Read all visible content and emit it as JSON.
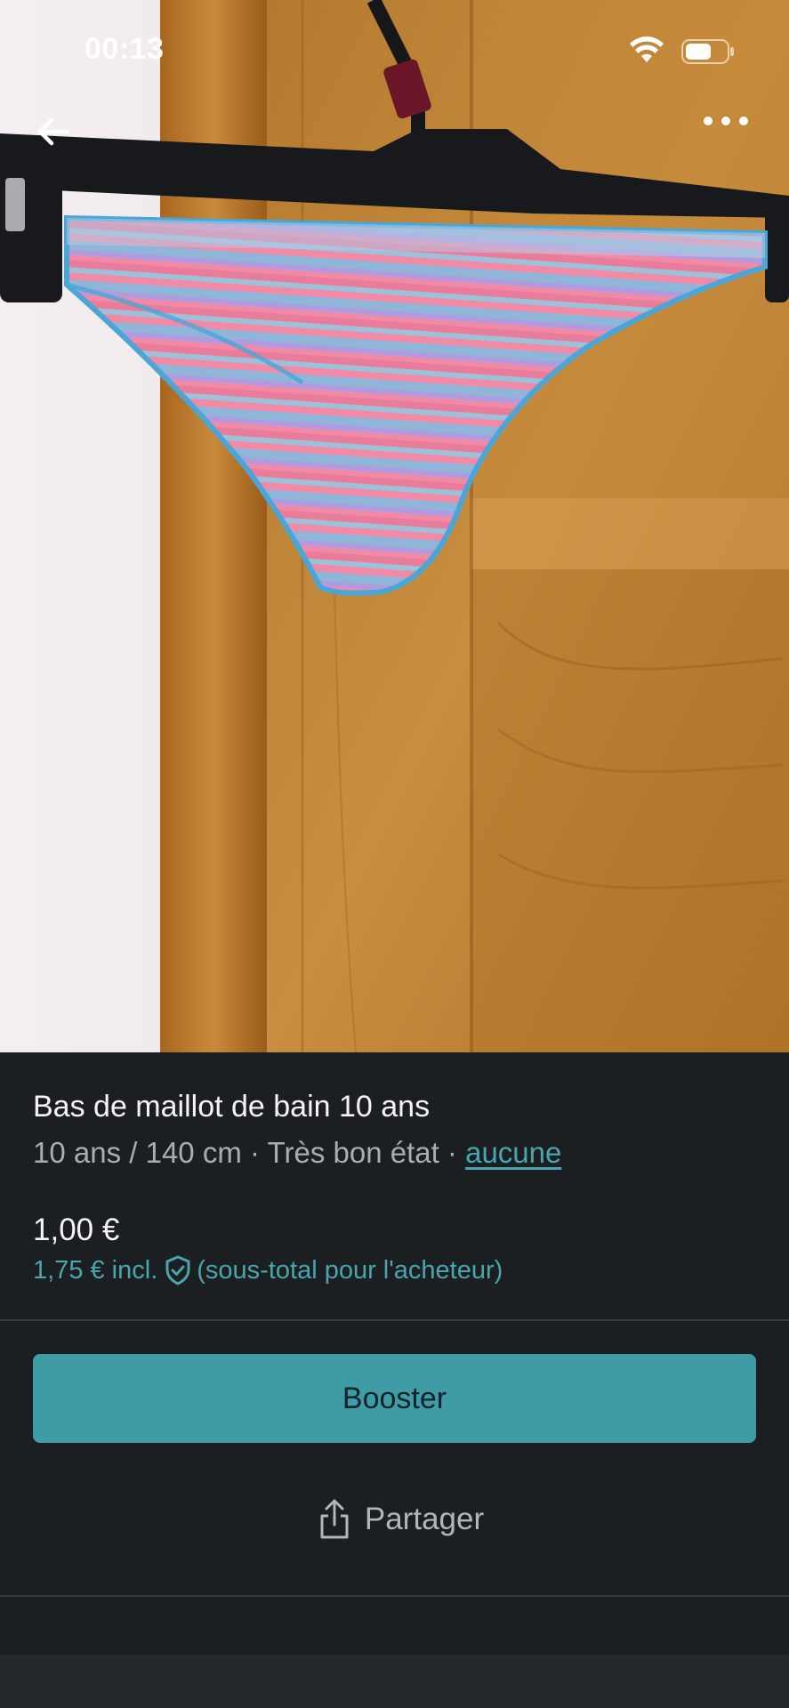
{
  "status_bar": {
    "time": "00:13"
  },
  "product": {
    "title": "Bas de maillot de bain 10 ans",
    "size": "10 ans / 140 cm",
    "condition": "Très bon état",
    "brand": "aucune",
    "separator": " · ",
    "price": "1,00 €",
    "price_incl": "1,75 € incl.",
    "price_note": "(sous-total pour l'acheteur)"
  },
  "actions": {
    "boost_label": "Booster",
    "share_label": "Partager"
  },
  "icons": {
    "back": "arrow-left-icon",
    "more": "more-dots-icon",
    "wifi": "wifi-icon",
    "battery": "battery-icon",
    "shield": "shield-check-icon",
    "share": "share-icon"
  },
  "colors": {
    "accent": "#3f9ca6",
    "link": "#4aa5ae",
    "background": "#1b1f21"
  }
}
